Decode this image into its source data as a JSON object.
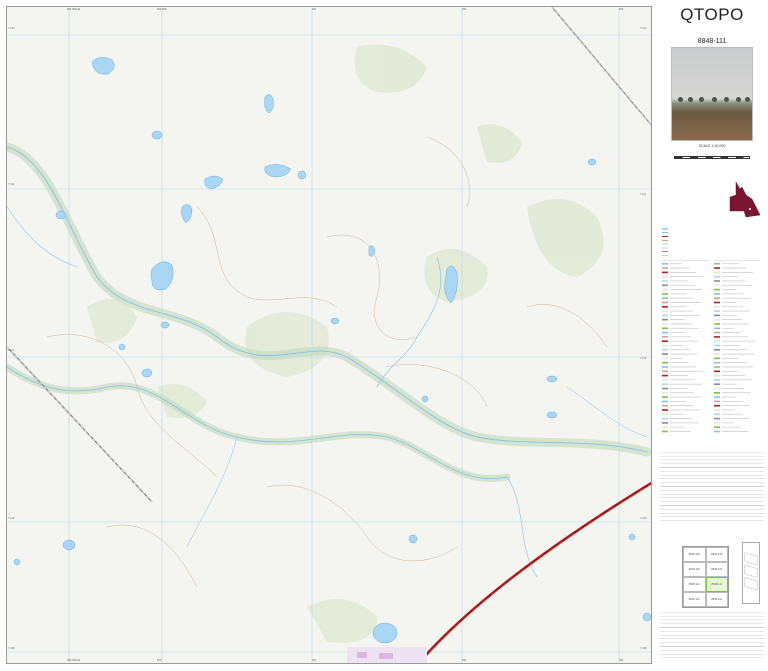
{
  "map": {
    "edge_ticks": {
      "top": [
        "689 000mE",
        "690 000",
        "691",
        "692",
        "693"
      ],
      "bottom": [
        "689 000mE",
        "690",
        "691",
        "692",
        "693"
      ],
      "left": [
        "7 112",
        "7 111",
        "7 110",
        "7 109",
        "7 108"
      ],
      "right": [
        "7 112",
        "7 111",
        "7 110",
        "7 109",
        "7 108"
      ]
    },
    "colors": {
      "water": "#a9d6f5",
      "water_outline": "#6aaede",
      "grid": "#b7d9ea",
      "contour": "#c4a486",
      "vegetation": "#dfe9d2",
      "road": "#b21e1e",
      "paper": "#f4f4f1"
    }
  },
  "sidebar": {
    "title": "QTOPO",
    "sheet_number": "8848-111",
    "scale": "SCALE 1:10,000",
    "index_cells": [
      "8848-432",
      "8848-433",
      "8848-423",
      "8848-422",
      "8848-114",
      "8848-111",
      "8848-113",
      "8848-112"
    ]
  }
}
